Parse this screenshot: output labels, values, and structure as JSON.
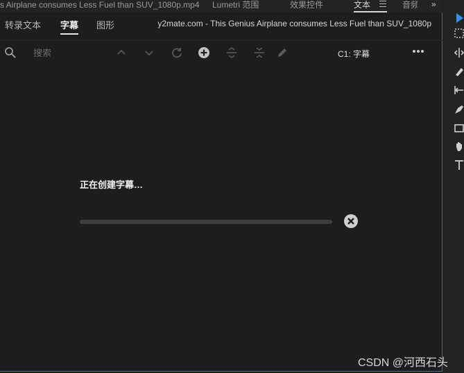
{
  "top_tabs": {
    "file_tab": "s Airplane consumes Less Fuel than SUV_1080p.mp4",
    "lumetri_tab": "Lumetri 范围",
    "effects_tab": "效果控件",
    "text_tab": "文本",
    "audio_tab": "音频",
    "more_label": "»"
  },
  "sub_tabs": {
    "transcript": "转录文本",
    "captions": "字幕",
    "graphics": "图形"
  },
  "file_title": "y2mate.com - This Genius Airplane consumes Less Fuel than SUV_1080p",
  "toolbar": {
    "search_placeholder": "搜索",
    "track_label": "C1: 字幕"
  },
  "status": {
    "message": "正在创建字幕…",
    "progress": 0
  },
  "watermark": "CSDN @河西石头",
  "colors": {
    "background": "#1d1d1d",
    "accent": "#3a6fc7",
    "text": "#f2f2f2"
  },
  "icons": {
    "search": "search-icon",
    "up": "chevron-up-icon",
    "down": "chevron-down-icon",
    "refresh": "refresh-icon",
    "add": "add-circle-icon",
    "split": "split-icon",
    "merge": "merge-icon",
    "edit": "pencil-icon",
    "more": "more-dots-icon",
    "cancel": "cancel-circle-icon"
  }
}
